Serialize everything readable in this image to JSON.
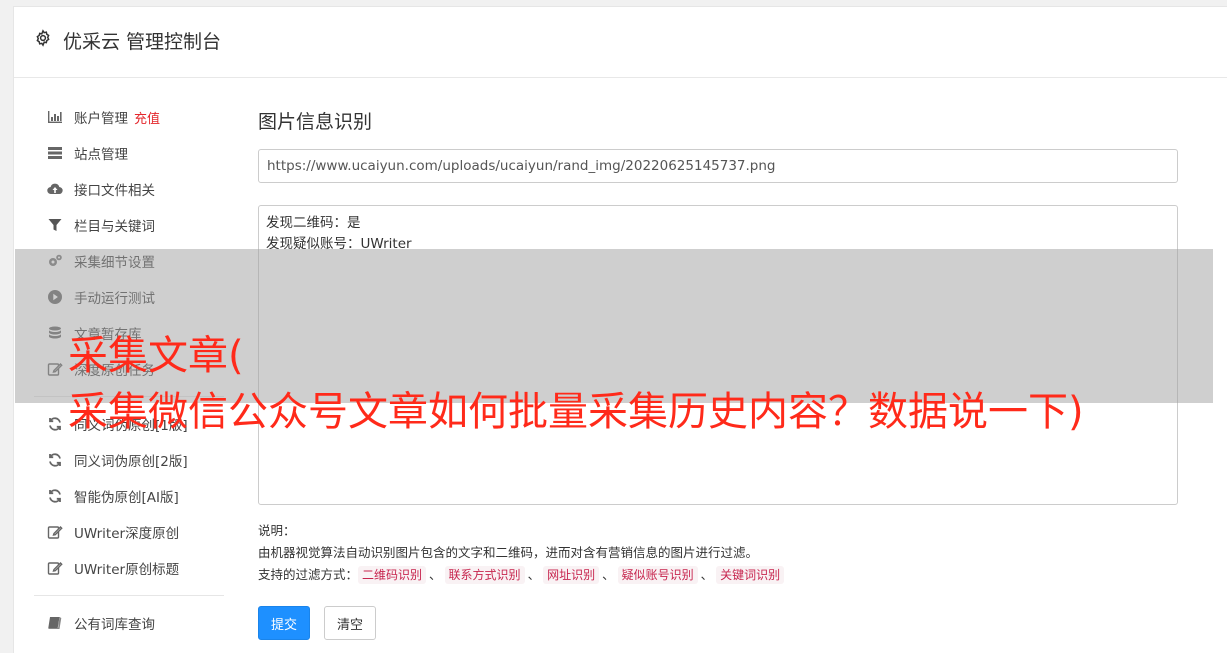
{
  "header": {
    "title": "优采云 管理控制台",
    "icon": "gear-icon"
  },
  "sidebar": {
    "items": [
      {
        "label": "账户管理",
        "extra": "充值",
        "icon": "bar-chart-icon"
      },
      {
        "label": "站点管理",
        "icon": "server-icon"
      },
      {
        "label": "接口文件相关",
        "icon": "cloud-upload-icon"
      },
      {
        "label": "栏目与关键词",
        "icon": "filter-icon"
      },
      {
        "label": "采集细节设置",
        "icon": "gears-icon"
      },
      {
        "label": "手动运行测试",
        "icon": "play-circle-icon"
      },
      {
        "label": "文章暂存库",
        "icon": "database-icon"
      },
      {
        "label": "深度原创任务",
        "icon": "edit-icon"
      }
    ],
    "items2": [
      {
        "label": "同义词伪原创[1版]",
        "icon": "refresh-icon"
      },
      {
        "label": "同义词伪原创[2版]",
        "icon": "refresh-icon"
      },
      {
        "label": "智能伪原创[AI版]",
        "icon": "refresh-icon"
      },
      {
        "label": "UWriter深度原创",
        "icon": "edit-icon"
      },
      {
        "label": "UWriter原创标题",
        "icon": "edit-icon"
      }
    ],
    "items3": [
      {
        "label": "公有词库查询",
        "icon": "book-icon"
      }
    ]
  },
  "main": {
    "title": "图片信息识别",
    "url_value": "https://www.ucaiyun.com/uploads/ucaiyun/rand_img/20220625145737.png",
    "result_lines": [
      "发现二维码：是",
      "发现疑似账号：UWriter"
    ],
    "notes_label": "说明：",
    "notes_desc": "由机器视觉算法自动识别图片包含的文字和二维码，进而对含有营销信息的图片进行过滤。",
    "filters_label": "支持的过滤方式：",
    "filters": [
      "二维码识别",
      "联系方式识别",
      "网址识别",
      "疑似账号识别",
      "关键词识别"
    ],
    "separator": "、",
    "submit_label": "提交",
    "clear_label": "清空"
  },
  "overlay": {
    "line1": "采集文章(",
    "line2": "采集微信公众号文章如何批量采集历史内容？数据说一下)"
  },
  "colors": {
    "primary": "#1e90ff",
    "recharge": "#e4262b",
    "tag_text": "#c7254e",
    "overlay_text": "#ff2a1a"
  }
}
